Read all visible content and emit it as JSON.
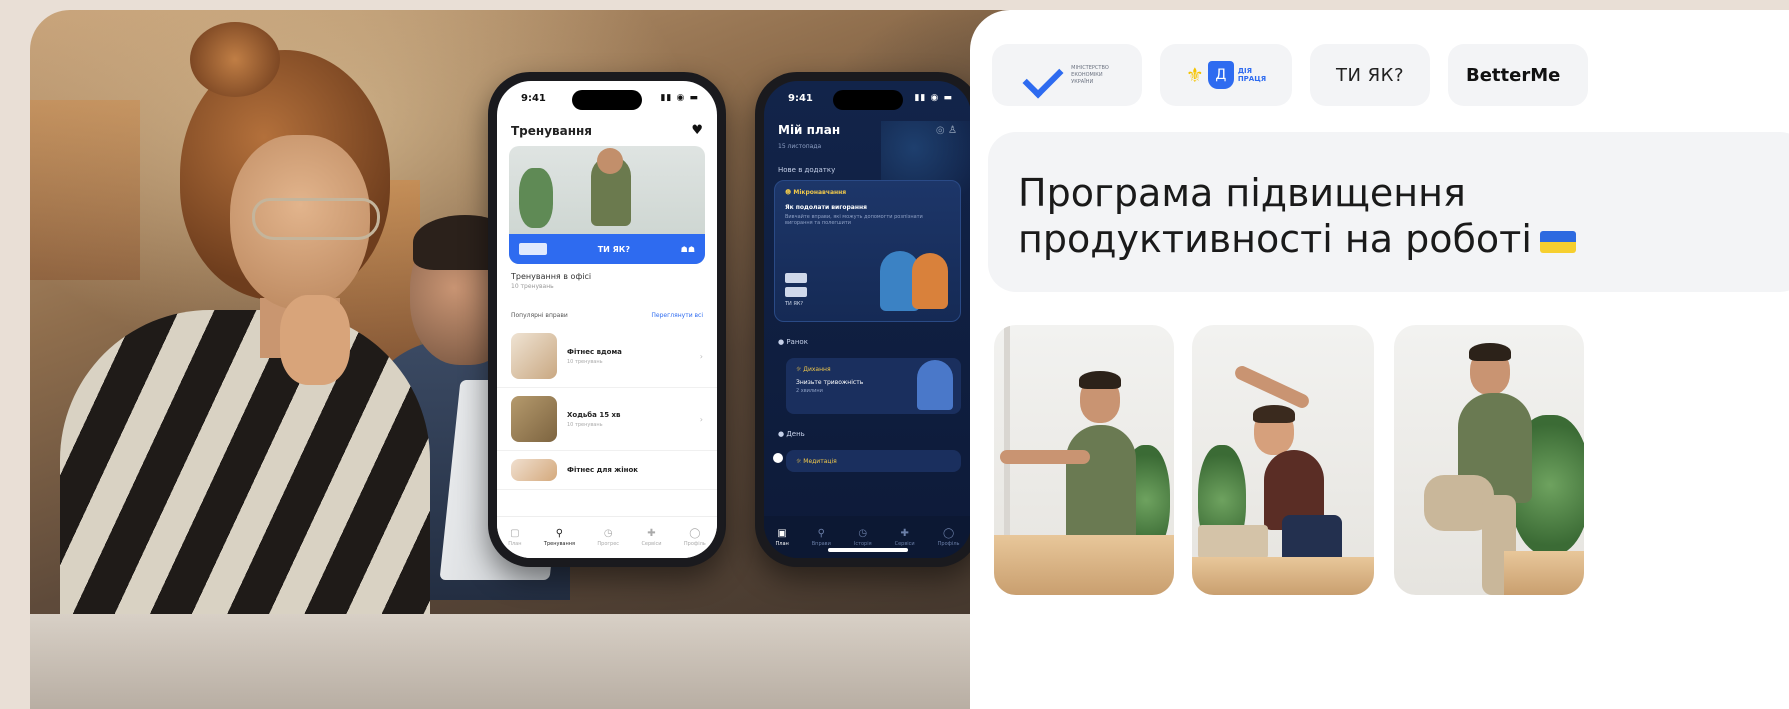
{
  "colors": {
    "accent_blue": "#2e6bf0",
    "flag_blue": "#2d6ae0",
    "flag_yellow": "#f6cf2f",
    "background": "#e9dfd6",
    "dark_app": "#12244a"
  },
  "light_phone": {
    "time": "9:41",
    "status_icons": "▮▮ ◉ ▬",
    "title": "Тренування",
    "heart_icon": "heart-icon",
    "card": {
      "band_brand": "ТИ ЯК?",
      "band_mark": "☗☗"
    },
    "card_title": "Тренування в офісі",
    "card_meta": "10 тренувань",
    "section": "Популярні вправи",
    "section_link": "Переглянути всі",
    "items": [
      {
        "title": "Фітнес вдома",
        "meta": "10 тренувань"
      },
      {
        "title": "Ходьба 15 хв",
        "meta": "10 тренувань"
      },
      {
        "title": "Фітнес для жінок",
        "meta": ""
      }
    ],
    "tabs": [
      {
        "icon": "▢",
        "label": "План"
      },
      {
        "icon": "⚲",
        "label": "Тренування"
      },
      {
        "icon": "◷",
        "label": "Прогрес"
      },
      {
        "icon": "✚",
        "label": "Сервіси"
      },
      {
        "icon": "◯",
        "label": "Профіль"
      }
    ]
  },
  "dark_phone": {
    "time": "9:41",
    "status_icons": "▮▮ ◉ ▬",
    "title": "Мій план",
    "subtitle": "15 листопада",
    "icons": "◎ ♙",
    "section_new": "Нове в додатку",
    "card_tag": "☻ Мікронавчання",
    "card_title": "Як подолати вигорання",
    "card_text": "Вивчайте вправи, які можуть допомогти розпізнати вигорання та полегшити",
    "card_logo_label": "ТИ ЯК?",
    "section_morning": "● Ранок",
    "card2_tag": "☼ Дихання",
    "card2_title": "Знизьте тривожність",
    "card2_meta": "2 хвилини",
    "section_day": "● День",
    "card3_tag": "☼ Медитація",
    "tabs": [
      {
        "icon": "▣",
        "label": "План"
      },
      {
        "icon": "⚲",
        "label": "Вправи"
      },
      {
        "icon": "◷",
        "label": "Історія"
      },
      {
        "icon": "✚",
        "label": "Сервіси"
      },
      {
        "icon": "◯",
        "label": "Профіль"
      }
    ]
  },
  "partners": {
    "ministry_lines": [
      "МІНІСТЕРСТВО",
      "ЕКОНОМІКИ",
      "УКРАЇНИ"
    ],
    "gov_tryzub": "⚜",
    "gov_shield": "Д",
    "gov_text_lines": [
      "ДІЯ",
      "ПРАЦЯ"
    ],
    "tiyak": "ТИ ЯК?",
    "better": "BetterMe"
  },
  "headline": {
    "line1": "Програма підвищення",
    "line2": "продуктивності на роботі"
  }
}
